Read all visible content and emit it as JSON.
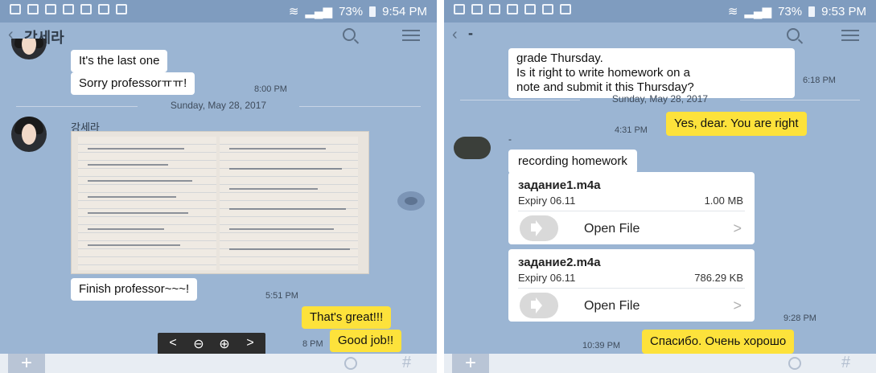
{
  "left": {
    "status_time": "9:54 PM",
    "status_battery": "73%",
    "header_title": "강세라",
    "messages": [
      {
        "text": "It's the last one"
      },
      {
        "text": "Sorry professorㅠㅠ!",
        "time": "8:00 PM"
      }
    ],
    "date_separator": "Sunday, May 28, 2017",
    "sender": "강세라",
    "finish_msg": "Finish professor~~~!",
    "finish_time": "5:51 PM",
    "reply1": "That's great!!!",
    "reply2": "Good job!!",
    "reply2_time": "8 PM",
    "viewer_controls": [
      "<",
      "⊖",
      "⊕",
      ">"
    ],
    "hash": "#"
  },
  "right": {
    "status_time": "9:53 PM",
    "status_battery": "73%",
    "header_title": "-",
    "top_msg": "grade Thursday.\nIs it right to write homework on a\nnote and submit it this Thursday?",
    "top_time": "6:18 PM",
    "date_separator": "Sunday, May 28, 2017",
    "reply": "Yes, dear. You are right",
    "reply_time": "4:31 PM",
    "sender": "-",
    "recording_msg": "recording homework",
    "files": [
      {
        "name": "задание1.m4a",
        "expiry": "Expiry 06.11",
        "size": "1.00 MB",
        "action": "Open File"
      },
      {
        "name": "задание2.m4a",
        "expiry": "Expiry 06.11",
        "size": "786.29 KB",
        "action": "Open File"
      }
    ],
    "files_time": "9:28 PM",
    "last_reply": "Спасибо.  Очень хорошо",
    "last_time": "10:39 PM",
    "hash": "#"
  }
}
